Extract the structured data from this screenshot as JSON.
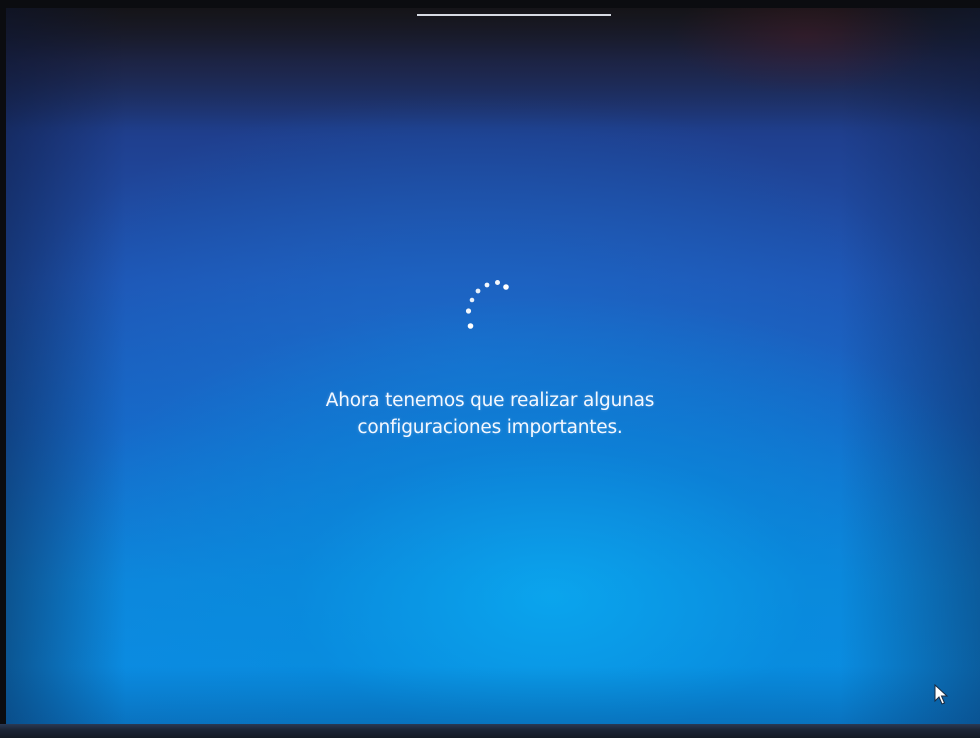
{
  "setup_screen": {
    "message_line1": "Ahora tenemos que realizar algunas",
    "message_line2": "configuraciones importantes.",
    "spinner_icon": "loading-dots-spinner-icon",
    "cursor_icon": "mouse-pointer-icon",
    "colors": {
      "background_top": "#1f3f8e",
      "background_bottom": "#0a8fe6",
      "text": "#f4f8ff"
    }
  }
}
